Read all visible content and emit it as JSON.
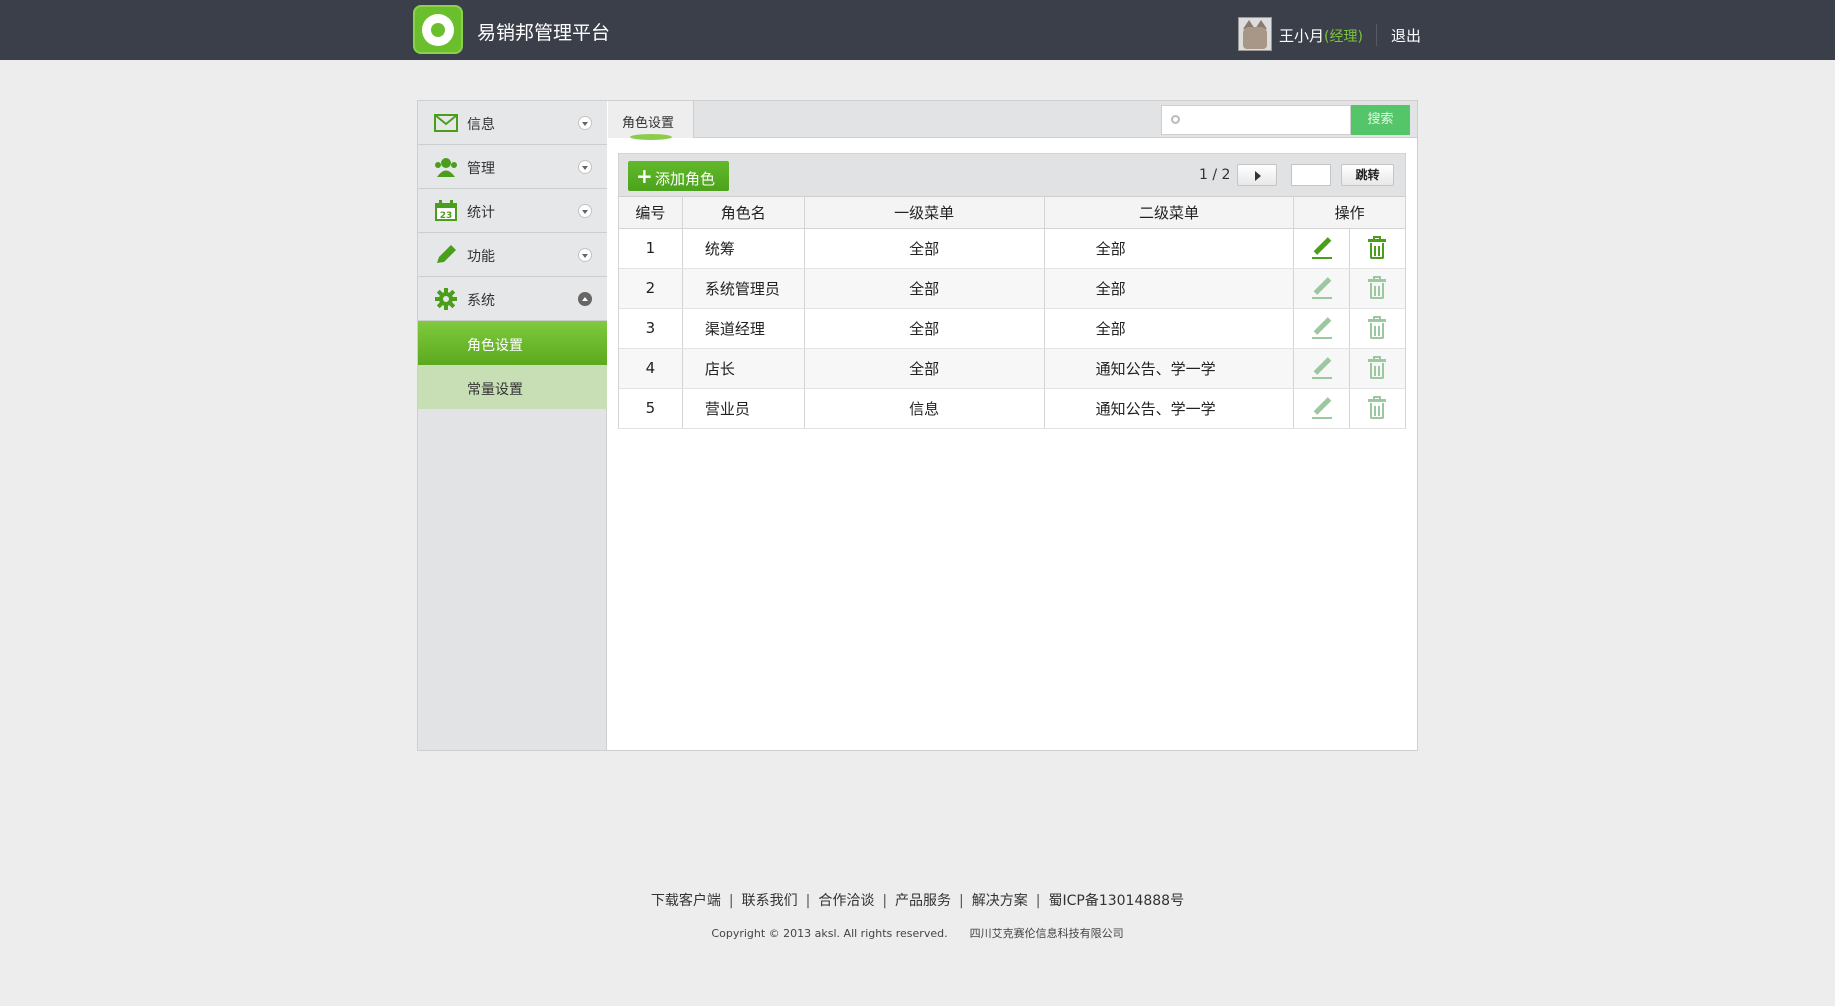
{
  "header": {
    "app_title": "易销邦管理平台",
    "user_name": "王小月",
    "user_role": "(经理)",
    "logout": "退出"
  },
  "sidebar": {
    "items": [
      {
        "label": "信息",
        "icon": "envelope-icon",
        "expanded": false
      },
      {
        "label": "管理",
        "icon": "users-icon",
        "expanded": false
      },
      {
        "label": "统计",
        "icon": "calendar-icon",
        "calendar_number": "23",
        "expanded": false
      },
      {
        "label": "功能",
        "icon": "pencil-icon",
        "expanded": false
      },
      {
        "label": "系统",
        "icon": "gear-icon",
        "expanded": true
      }
    ],
    "subitems": [
      {
        "label": "角色设置",
        "active": true
      },
      {
        "label": "常量设置",
        "active": false
      }
    ]
  },
  "content": {
    "tab_label": "角色设置",
    "search_placeholder": "",
    "search_button": "搜索",
    "add_button": "添加角色",
    "pager": "1 / 2",
    "jump_button": "跳转",
    "columns": [
      "编号",
      "角色名",
      "一级菜单",
      "二级菜单",
      "操作"
    ],
    "rows": [
      {
        "id": "1",
        "name": "统筹",
        "menu1": "全部",
        "menu2": "全部"
      },
      {
        "id": "2",
        "name": "系统管理员",
        "menu1": "全部",
        "menu2": "全部"
      },
      {
        "id": "3",
        "name": "渠道经理",
        "menu1": "全部",
        "menu2": "全部"
      },
      {
        "id": "4",
        "name": "店长",
        "menu1": "全部",
        "menu2": "通知公告、学一学"
      },
      {
        "id": "5",
        "name": "营业员",
        "menu1": "信息",
        "menu2": "通知公告、学一学"
      }
    ]
  },
  "footer": {
    "links": [
      "下载客户端",
      "联系我们",
      "合作洽谈",
      "产品服务",
      "解决方案",
      "蜀ICP备13014888号"
    ],
    "copyright": "Copyright © 2013 aksl. All rights reserved.",
    "company": "四川艾克赛伦信息科技有限公司"
  },
  "colors": {
    "topbar": "#3b3f4a",
    "accent_green": "#5ca91f",
    "icon_green": "#4a9e1c",
    "icon_green_faded": "#9cc8a0",
    "search_button": "#55c56a"
  }
}
